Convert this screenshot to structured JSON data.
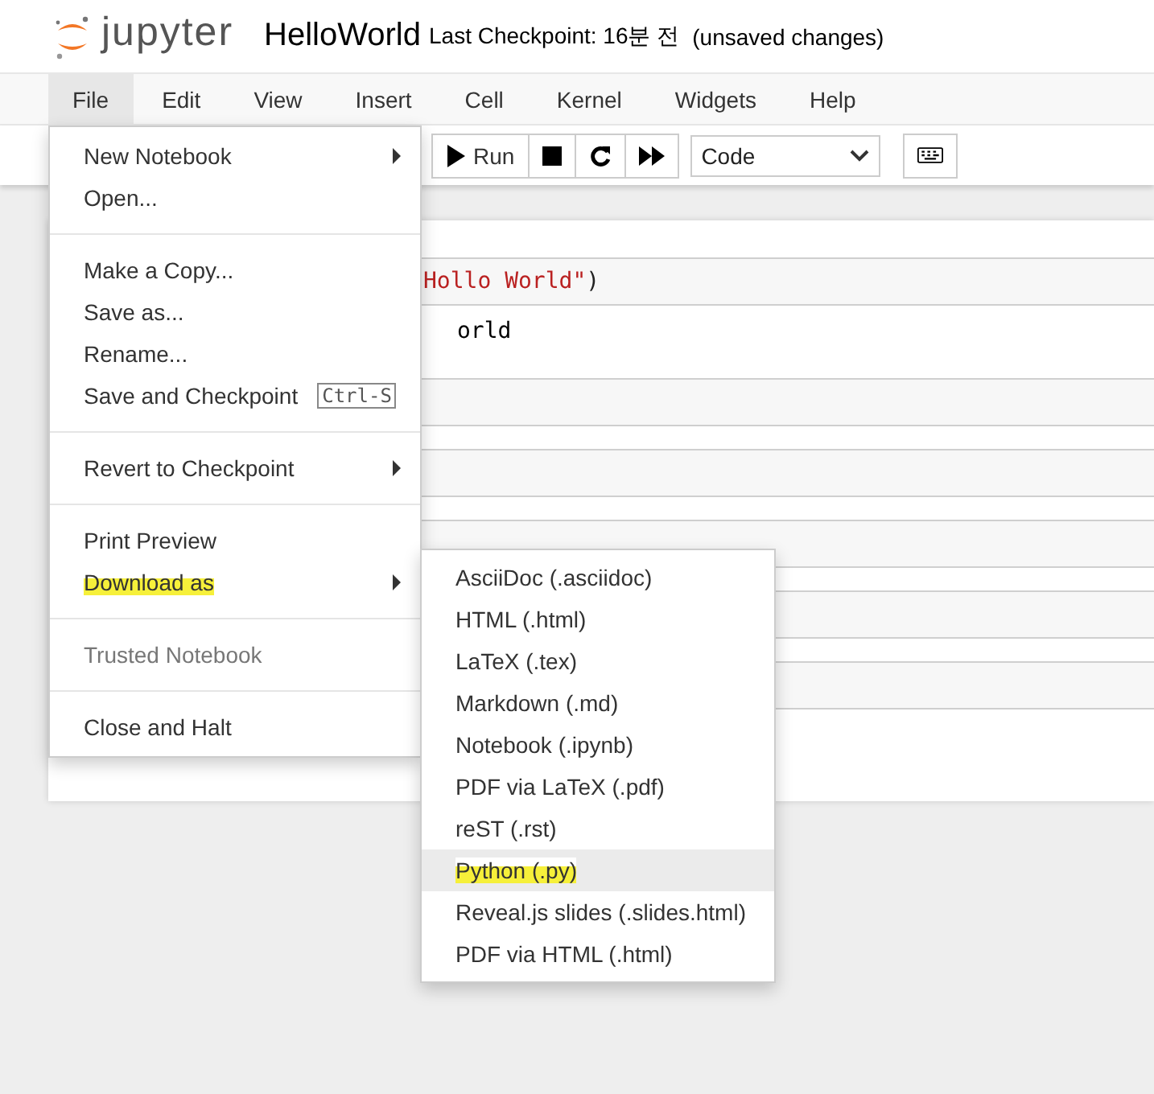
{
  "header": {
    "logo": "jupyter",
    "title": "HelloWorld",
    "checkpoint": "Last Checkpoint: 16분 전",
    "status": "(unsaved changes)"
  },
  "menubar": [
    {
      "label": "File",
      "selected": true
    },
    {
      "label": "Edit",
      "selected": false
    },
    {
      "label": "View",
      "selected": false
    },
    {
      "label": "Insert",
      "selected": false
    },
    {
      "label": "Cell",
      "selected": false
    },
    {
      "label": "Kernel",
      "selected": false
    },
    {
      "label": "Widgets",
      "selected": false
    },
    {
      "label": "Help",
      "selected": false
    }
  ],
  "toolbar": {
    "run_group": [
      {
        "kind": "run",
        "label": "Run"
      },
      {
        "kind": "stop"
      },
      {
        "kind": "restart"
      },
      {
        "kind": "fast_forward"
      }
    ],
    "cell_type": "Code",
    "extra": [
      {
        "kind": "keyboard"
      }
    ]
  },
  "cells": [
    {
      "kind": "code",
      "source": [
        {
          "kind": "string",
          "text": "Hollo World\""
        },
        {
          "kind": "plain",
          "text": ")"
        }
      ],
      "output": "orld"
    },
    {
      "kind": "code"
    },
    {
      "kind": "code"
    },
    {
      "kind": "code"
    },
    {
      "kind": "code"
    },
    {
      "kind": "code"
    }
  ],
  "file_menu": [
    [
      {
        "label": "New Notebook",
        "submenu": true,
        "disabled": false,
        "highlighted": false
      },
      {
        "label": "Open...",
        "submenu": false,
        "disabled": false,
        "highlighted": false
      }
    ],
    [
      {
        "label": "Make a Copy...",
        "submenu": false,
        "disabled": false,
        "highlighted": false
      },
      {
        "label": "Save as...",
        "submenu": false,
        "disabled": false,
        "highlighted": false
      },
      {
        "label": "Rename...",
        "submenu": false,
        "disabled": false,
        "highlighted": false
      },
      {
        "label": "Save and Checkpoint",
        "shortcut": "Ctrl-S",
        "submenu": false,
        "disabled": false,
        "highlighted": false
      }
    ],
    [
      {
        "label": "Revert to Checkpoint",
        "submenu": true,
        "disabled": false,
        "highlighted": false
      }
    ],
    [
      {
        "label": "Print Preview",
        "submenu": false,
        "disabled": false,
        "highlighted": false
      },
      {
        "label": "Download as",
        "submenu": true,
        "disabled": false,
        "highlighted": true
      }
    ],
    [
      {
        "label": "Trusted Notebook",
        "submenu": false,
        "disabled": true,
        "highlighted": false
      }
    ],
    [
      {
        "label": "Close and Halt",
        "submenu": false,
        "disabled": false,
        "highlighted": false
      }
    ]
  ],
  "download_submenu": [
    {
      "label": "AsciiDoc (.asciidoc)",
      "selected": false,
      "highlighted": false
    },
    {
      "label": "HTML (.html)",
      "selected": false,
      "highlighted": false
    },
    {
      "label": "LaTeX (.tex)",
      "selected": false,
      "highlighted": false
    },
    {
      "label": "Markdown (.md)",
      "selected": false,
      "highlighted": false
    },
    {
      "label": "Notebook (.ipynb)",
      "selected": false,
      "highlighted": false
    },
    {
      "label": "PDF via LaTeX (.pdf)",
      "selected": false,
      "highlighted": false
    },
    {
      "label": "reST (.rst)",
      "selected": false,
      "highlighted": false
    },
    {
      "label": "Python (.py)",
      "selected": true,
      "highlighted": true
    },
    {
      "label": "Reveal.js slides (.slides.html)",
      "selected": false,
      "highlighted": false
    },
    {
      "label": "PDF via HTML (.html)",
      "selected": false,
      "highlighted": false
    }
  ]
}
